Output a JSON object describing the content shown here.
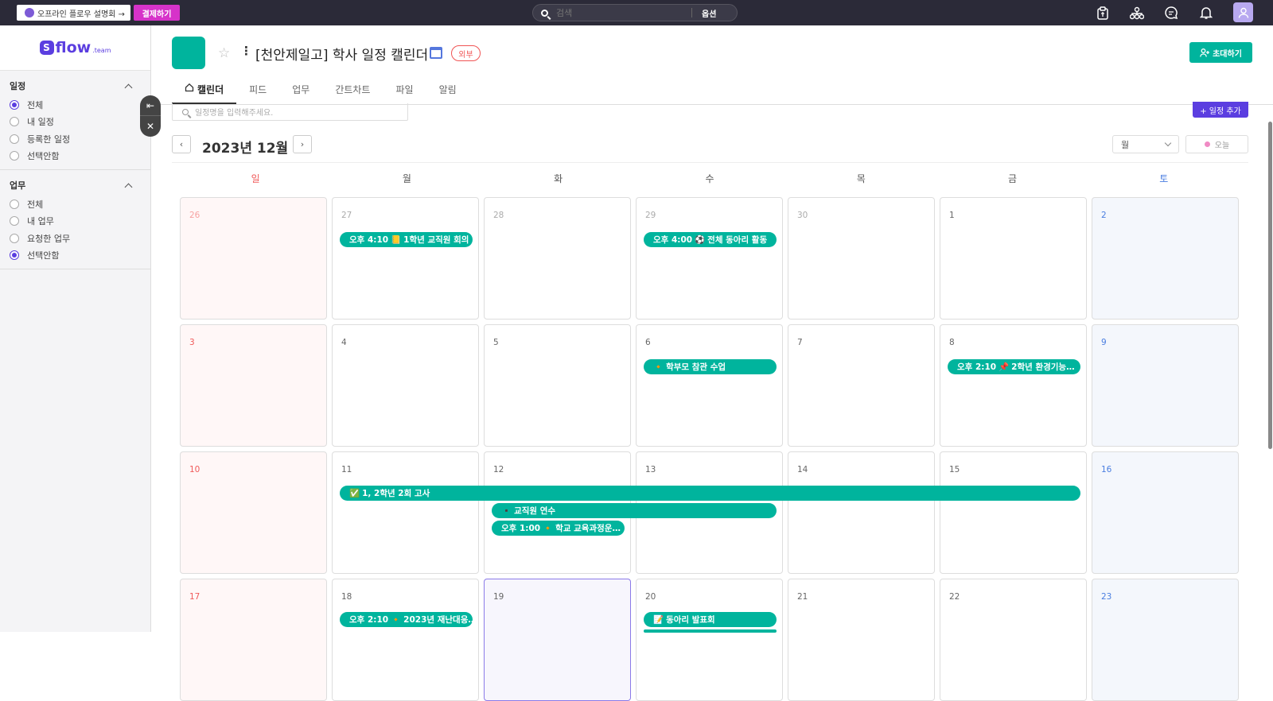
{
  "topbar": {
    "promo_label": "오프라인 플로우 설명회 →",
    "pay_label": "결제하기",
    "search_placeholder": "검색",
    "search_option": "옵션"
  },
  "sidebar": {
    "logo_text": "flow",
    "logo_sub": ".team",
    "schedule_title": "일정",
    "schedule_items": [
      {
        "label": "전체",
        "selected": true
      },
      {
        "label": "내 일정",
        "selected": false
      },
      {
        "label": "등록한 일정",
        "selected": false
      },
      {
        "label": "선택안함",
        "selected": false
      }
    ],
    "task_title": "업무",
    "task_items": [
      {
        "label": "전체",
        "selected": false
      },
      {
        "label": "내 업무",
        "selected": false
      },
      {
        "label": "요청한 업무",
        "selected": false
      },
      {
        "label": "선택안함",
        "selected": true
      }
    ]
  },
  "project": {
    "title": "[천안제일고] 학사 일정 캘린더",
    "badge": "외부",
    "invite_label": "초대하기",
    "color": "#00b49d"
  },
  "tabs": [
    "캘린더",
    "피드",
    "업무",
    "간트차트",
    "파일",
    "알림"
  ],
  "calendar": {
    "search_placeholder": "일정명을 입력해주세요.",
    "add_label": "+ 일정 추가",
    "month_title": "2023년 12월",
    "view_label": "월",
    "today_label": "오늘",
    "weekdays": [
      "일",
      "월",
      "화",
      "수",
      "목",
      "금",
      "토"
    ],
    "weeks": [
      [
        "26",
        "27",
        "28",
        "29",
        "30",
        "1",
        "2"
      ],
      [
        "3",
        "4",
        "5",
        "6",
        "7",
        "8",
        "9"
      ],
      [
        "10",
        "11",
        "12",
        "13",
        "14",
        "15",
        "16"
      ],
      [
        "17",
        "18",
        "19",
        "20",
        "21",
        "22",
        "23"
      ]
    ],
    "events": [
      {
        "time": "오후 4:10",
        "emoji": "📒",
        "title": "1학년 교직원 회의"
      },
      {
        "time": "오후 4:00",
        "emoji": "⚽",
        "title": "전체 동아리 활동"
      },
      {
        "time": "",
        "emoji": "🔸",
        "title": "학부모 참관 수업"
      },
      {
        "time": "오후 2:10",
        "emoji": "📌",
        "title": "2학년 환경기능…"
      },
      {
        "time": "",
        "emoji": "✅",
        "title": "1, 2학년 2회 고사"
      },
      {
        "time": "",
        "emoji": "▪️",
        "title": "교직원 연수"
      },
      {
        "time": "오후 1:00",
        "emoji": "🔸",
        "title": "학교 교육과정운…"
      },
      {
        "time": "오후 2:10",
        "emoji": "🔸",
        "title": "2023년 재난대응…"
      },
      {
        "time": "",
        "emoji": "📝",
        "title": "동아리 발표회"
      }
    ]
  }
}
